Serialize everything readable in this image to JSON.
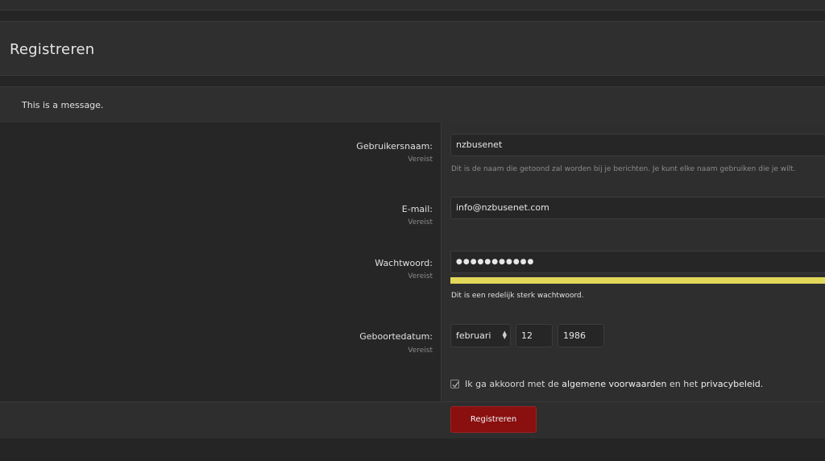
{
  "page": {
    "title": "Registreren"
  },
  "message": "This is a message.",
  "fields": {
    "username": {
      "label": "Gebruikersnaam:",
      "required": "Vereist",
      "value": "nzbusenet",
      "hint": "Dit is de naam die getoond zal worden bij je berichten. Je kunt elke naam gebruiken die je wilt."
    },
    "email": {
      "label": "E-mail:",
      "required": "Vereist",
      "value": "info@nzbusenet.com"
    },
    "password": {
      "label": "Wachtwoord:",
      "required": "Vereist",
      "value": "●●●●●●●●●●●",
      "strength_text": "Dit is een redelijk sterk wachtwoord.",
      "strength_color": "#e2d85a"
    },
    "birthdate": {
      "label": "Geboortedatum:",
      "required": "Vereist",
      "month": "februari",
      "day": "12",
      "year": "1986"
    }
  },
  "agree": {
    "checked": true,
    "text_before": "Ik ga akkoord met de ",
    "terms_link": "algemene voorwaarden",
    "text_mid": " en het ",
    "privacy_link": "privacybeleid",
    "text_after": "."
  },
  "submit_label": "Registreren",
  "colors": {
    "accent": "#8a0f0f",
    "background": "#252525",
    "panel": "#2e2e2e"
  }
}
